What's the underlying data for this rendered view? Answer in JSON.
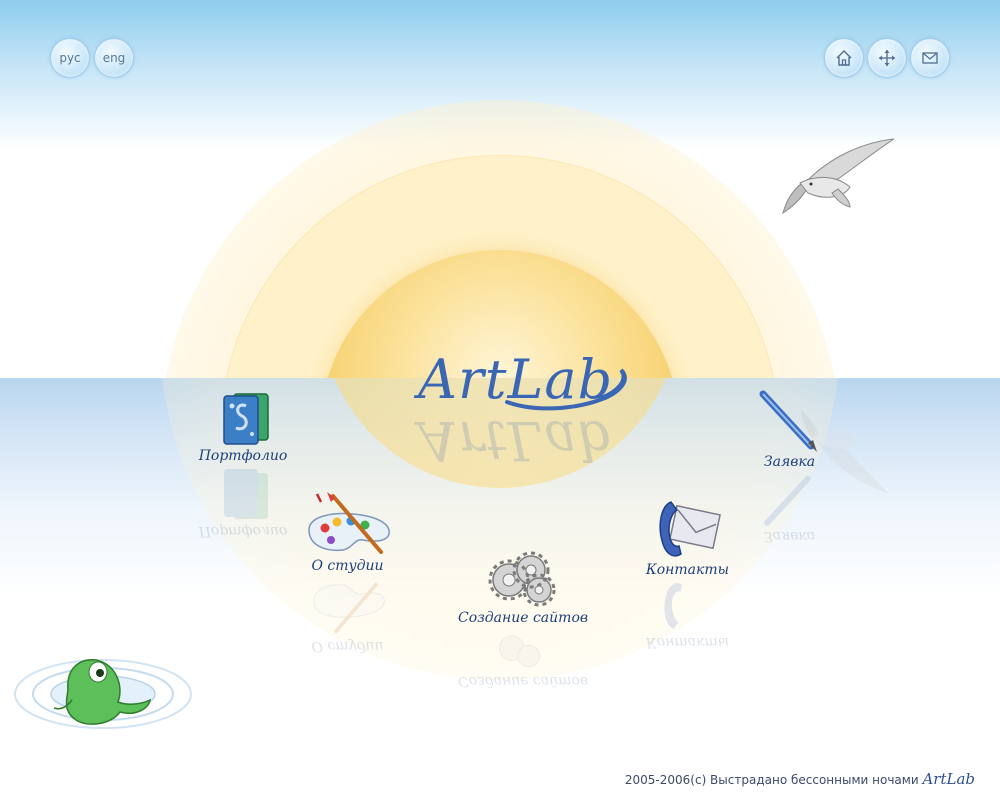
{
  "language_bar": {
    "items": [
      {
        "label": "рус"
      },
      {
        "label": "eng"
      }
    ]
  },
  "toolbar": {
    "items": [
      {
        "icon": "home-icon"
      },
      {
        "icon": "move-icon"
      },
      {
        "icon": "mail-icon"
      }
    ]
  },
  "logo": {
    "text": "ArtLab"
  },
  "nav": {
    "portfolio": {
      "label": "Портфолио",
      "icon": "portfolio-icon"
    },
    "about": {
      "label": "О студии",
      "icon": "palette-icon"
    },
    "web": {
      "label": "Создание сайтов",
      "icon": "gears-icon"
    },
    "contacts": {
      "label": "Контакты",
      "icon": "phone-mail-icon"
    },
    "order": {
      "label": "Заявка",
      "icon": "pen-icon"
    }
  },
  "footer": {
    "text": "2005-2006(c) Выстрадано бессонными ночами",
    "brand": "ArtLab"
  },
  "colors": {
    "sky_top": "#8fcdee",
    "sun": "#f5cc62",
    "logo": "#3a66b4",
    "nav_text": "#1e3f7a"
  }
}
